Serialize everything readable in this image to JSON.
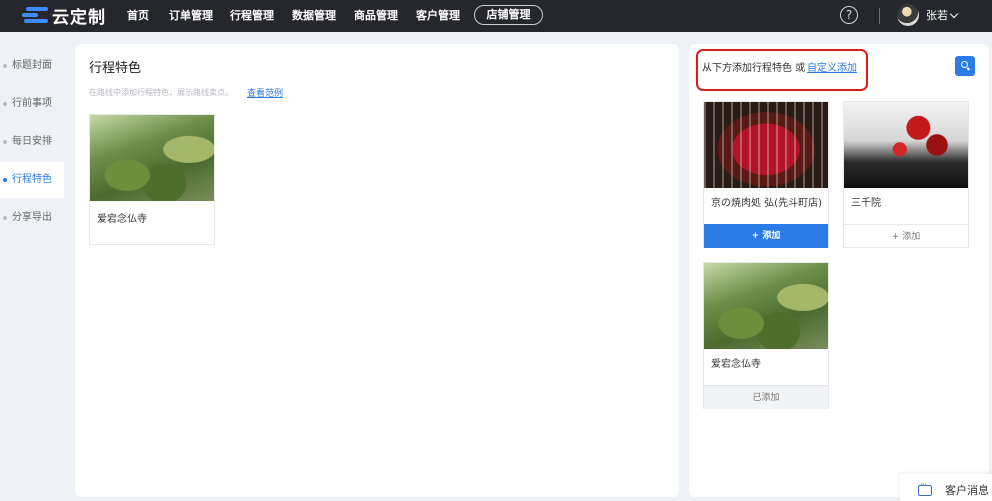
{
  "brand": {
    "name": "云定制",
    "accent": "#2a7be6"
  },
  "nav": {
    "items": [
      "首页",
      "订单管理",
      "行程管理",
      "数据管理",
      "商品管理",
      "客户管理"
    ],
    "store_button": "店铺管理",
    "help": "?",
    "username": "张若"
  },
  "sidebar": {
    "items": [
      {
        "label": "标题封面"
      },
      {
        "label": "行前事项"
      },
      {
        "label": "每日安排"
      },
      {
        "label": "行程特色",
        "active": true
      },
      {
        "label": "分享导出"
      }
    ]
  },
  "main": {
    "title": "行程特色",
    "hint": "在路线中添加行程特色，展示路线卖点。",
    "hint_link": "查看范例",
    "features": [
      {
        "name": "爱宕念仏寺",
        "image": "temple"
      }
    ]
  },
  "right": {
    "prompt": "从下方添加行程特色 或",
    "custom_link": "自定义添加",
    "items": [
      {
        "name": "京の焼肉処 弘(先斗町店)",
        "image": "yakiniku",
        "action": "+ 添加",
        "state": "highlighted"
      },
      {
        "name": "三千院",
        "image": "sanzen",
        "action": "+ 添加",
        "state": "default"
      },
      {
        "name": "爱宕念仏寺",
        "image": "temple",
        "action": "已添加",
        "state": "added"
      }
    ]
  },
  "chat": {
    "label": "客户消息"
  }
}
